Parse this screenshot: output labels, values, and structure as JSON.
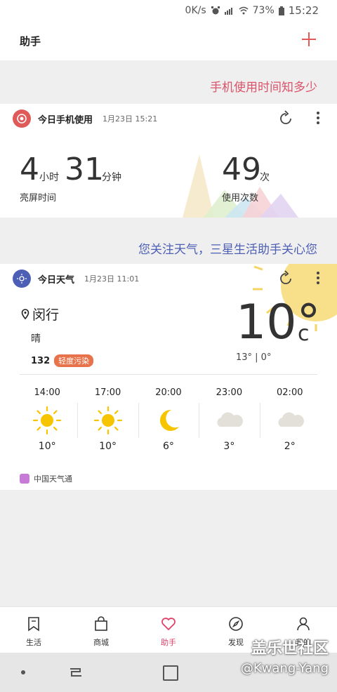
{
  "status_bar": {
    "speed": "0K/s",
    "battery": "73%",
    "time": "15:22"
  },
  "header": {
    "title": "助手"
  },
  "promos": {
    "usage": "手机使用时间知多少",
    "weather": "您关注天气，三星生活助手关心您"
  },
  "usage_card": {
    "title": "今日手机使用",
    "timestamp": "1月23日 15:21",
    "hours": "4",
    "hours_unit": "小时",
    "minutes": "31",
    "minutes_unit": "分钟",
    "screen_label": "亮屏时间",
    "unlocks": "49",
    "unlocks_unit": "次",
    "unlocks_label": "使用次数"
  },
  "weather_card": {
    "title": "今日天气",
    "timestamp": "1月23日 11:01",
    "location": "闵行",
    "condition": "晴",
    "aqi_value": "132",
    "aqi_label": "轻度污染",
    "temp": "10°",
    "temp_unit": "c",
    "range": "13° | 0°",
    "forecast": [
      {
        "time": "14:00",
        "icon": "sun-icon",
        "temp": "10°"
      },
      {
        "time": "17:00",
        "icon": "sun-icon",
        "temp": "10°"
      },
      {
        "time": "20:00",
        "icon": "moon-icon",
        "temp": "6°"
      },
      {
        "time": "23:00",
        "icon": "cloud-icon",
        "temp": "3°"
      },
      {
        "time": "02:00",
        "icon": "cloud-icon",
        "temp": "2°"
      }
    ],
    "source": "中国天气通"
  },
  "bottom_nav": [
    {
      "label": "生活",
      "icon": "bookmark-icon"
    },
    {
      "label": "商城",
      "icon": "shopping-bag-icon"
    },
    {
      "label": "助手",
      "icon": "heart-icon",
      "active": true
    },
    {
      "label": "发现",
      "icon": "compass-icon"
    },
    {
      "label": "我的",
      "icon": "person-icon"
    }
  ],
  "watermark": {
    "line1": "盖乐世社区",
    "line2": "@Kwang-Yang"
  },
  "colors": {
    "accent_red": "#e0436a",
    "promo_blue": "#4d5fb5",
    "aqi_orange": "#e8734a",
    "sun_yellow": "#f7c400"
  }
}
